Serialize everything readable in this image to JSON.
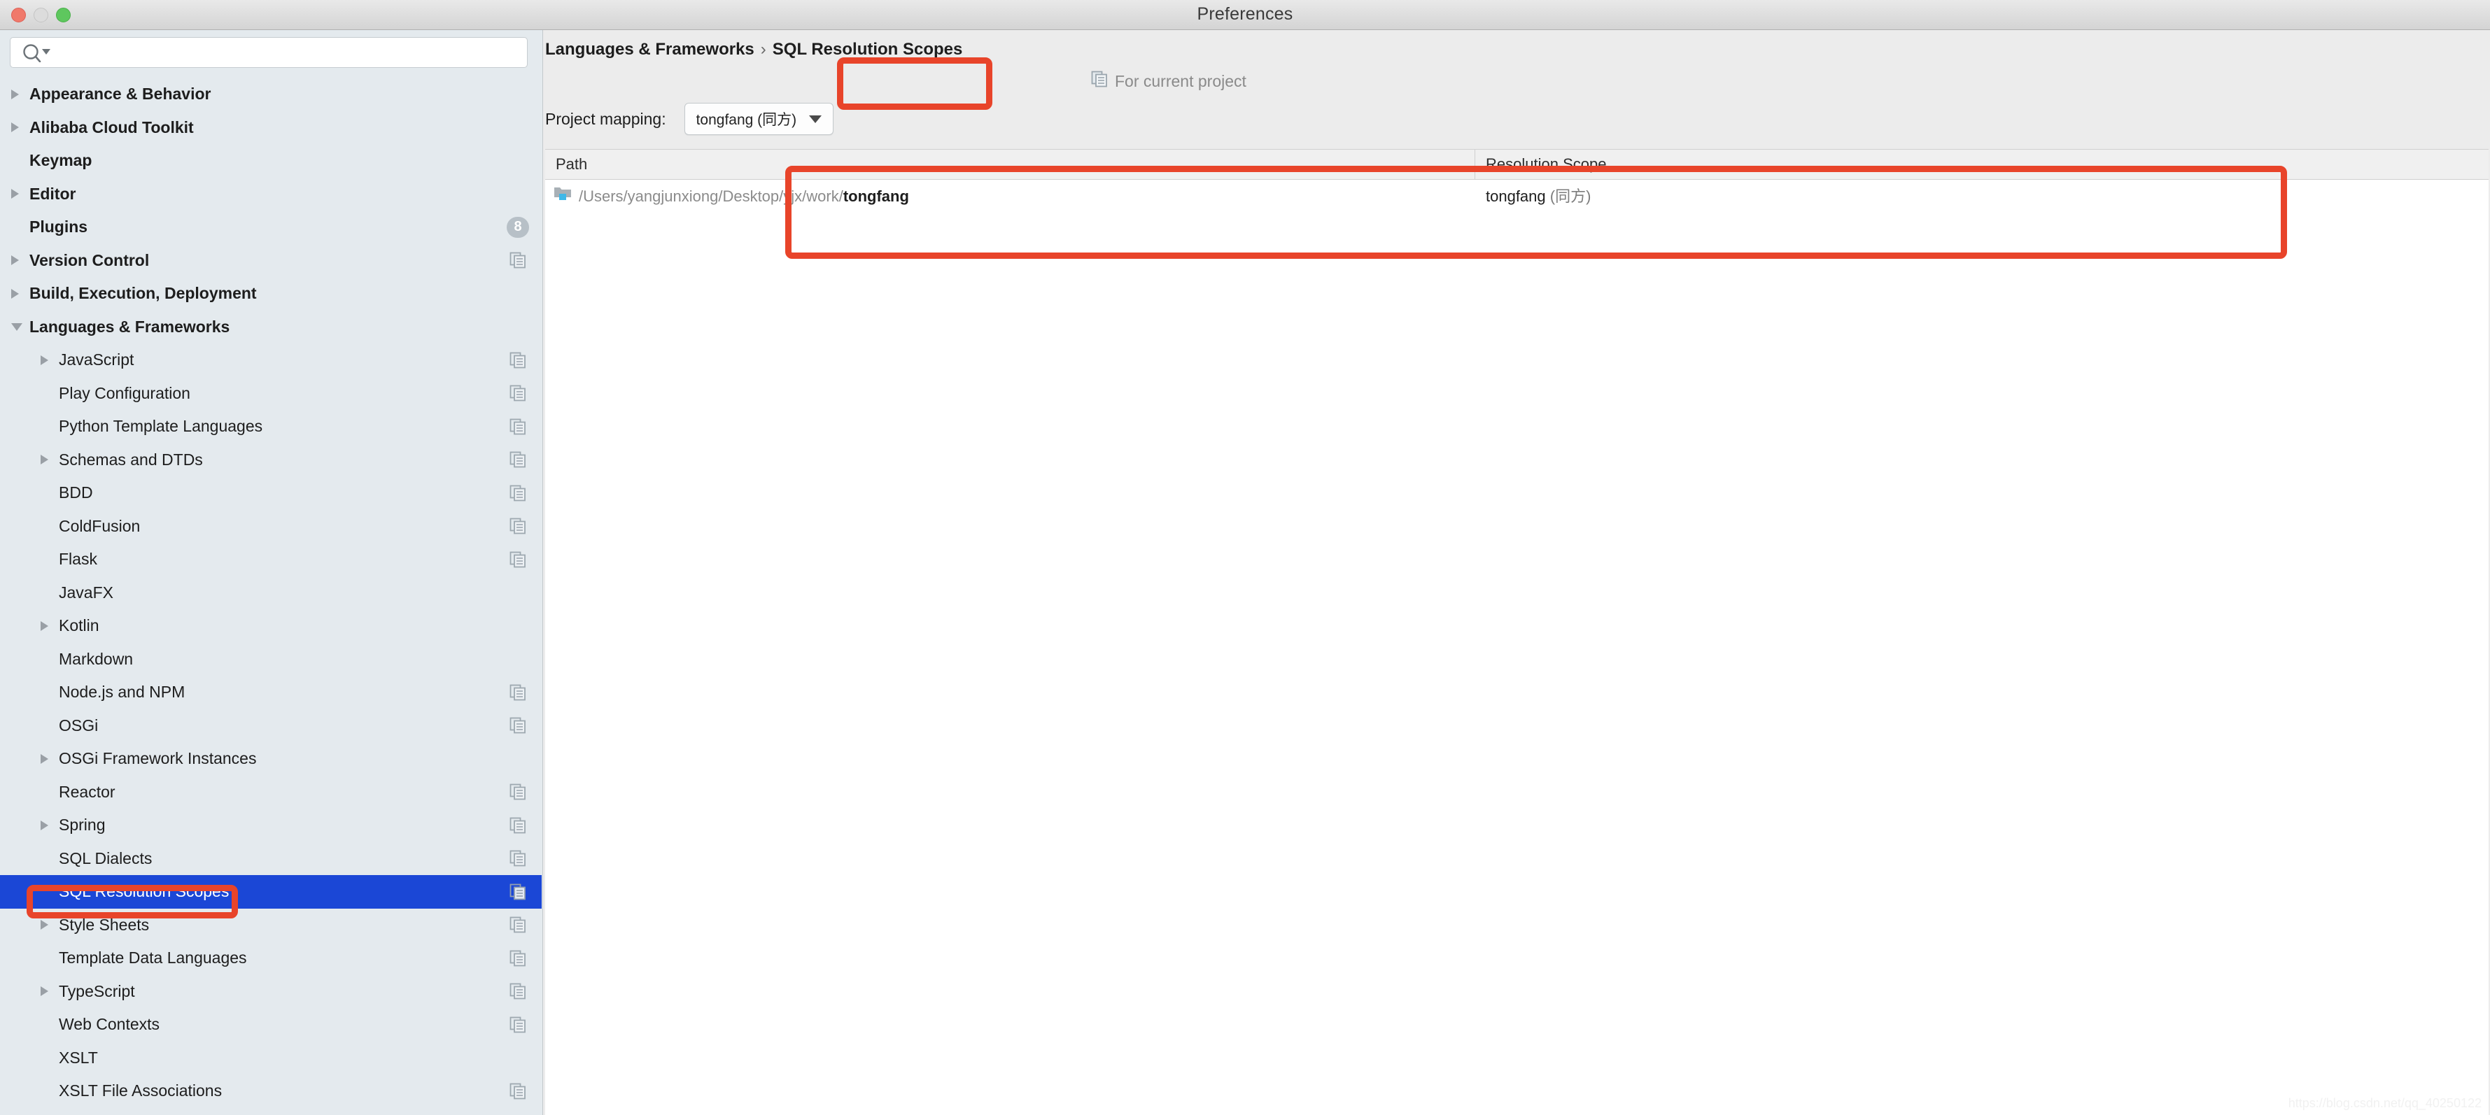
{
  "window": {
    "title": "Preferences",
    "controls": [
      "close",
      "minimize",
      "maximize"
    ]
  },
  "search": {
    "value": "",
    "placeholder": "",
    "icon": "search-icon"
  },
  "sidebar": {
    "items": [
      {
        "label": "Appearance & Behavior",
        "level": 0,
        "arrow": "collapsed",
        "icon": null,
        "badge": null,
        "selected": false
      },
      {
        "label": "Alibaba Cloud Toolkit",
        "level": 0,
        "arrow": "collapsed",
        "icon": null,
        "badge": null,
        "selected": false
      },
      {
        "label": "Keymap",
        "level": 0,
        "arrow": "none",
        "icon": null,
        "badge": null,
        "selected": false
      },
      {
        "label": "Editor",
        "level": 0,
        "arrow": "collapsed",
        "icon": null,
        "badge": null,
        "selected": false
      },
      {
        "label": "Plugins",
        "level": 0,
        "arrow": "none",
        "icon": null,
        "badge": "8",
        "selected": false
      },
      {
        "label": "Version Control",
        "level": 0,
        "arrow": "collapsed",
        "icon": "project-scope-icon",
        "badge": null,
        "selected": false
      },
      {
        "label": "Build, Execution, Deployment",
        "level": 0,
        "arrow": "collapsed",
        "icon": null,
        "badge": null,
        "selected": false
      },
      {
        "label": "Languages & Frameworks",
        "level": 0,
        "arrow": "expanded",
        "icon": null,
        "badge": null,
        "selected": false
      },
      {
        "label": "JavaScript",
        "level": 1,
        "arrow": "collapsed",
        "icon": "project-scope-icon",
        "badge": null,
        "selected": false
      },
      {
        "label": "Play Configuration",
        "level": 1,
        "arrow": "none",
        "icon": "project-scope-icon",
        "badge": null,
        "selected": false
      },
      {
        "label": "Python Template Languages",
        "level": 1,
        "arrow": "none",
        "icon": "project-scope-icon",
        "badge": null,
        "selected": false
      },
      {
        "label": "Schemas and DTDs",
        "level": 1,
        "arrow": "collapsed",
        "icon": "project-scope-icon",
        "badge": null,
        "selected": false
      },
      {
        "label": "BDD",
        "level": 1,
        "arrow": "none",
        "icon": "project-scope-icon",
        "badge": null,
        "selected": false
      },
      {
        "label": "ColdFusion",
        "level": 1,
        "arrow": "none",
        "icon": "project-scope-icon",
        "badge": null,
        "selected": false
      },
      {
        "label": "Flask",
        "level": 1,
        "arrow": "none",
        "icon": "project-scope-icon",
        "badge": null,
        "selected": false
      },
      {
        "label": "JavaFX",
        "level": 1,
        "arrow": "none",
        "icon": null,
        "badge": null,
        "selected": false
      },
      {
        "label": "Kotlin",
        "level": 1,
        "arrow": "collapsed",
        "icon": null,
        "badge": null,
        "selected": false
      },
      {
        "label": "Markdown",
        "level": 1,
        "arrow": "none",
        "icon": null,
        "badge": null,
        "selected": false
      },
      {
        "label": "Node.js and NPM",
        "level": 1,
        "arrow": "none",
        "icon": "project-scope-icon",
        "badge": null,
        "selected": false
      },
      {
        "label": "OSGi",
        "level": 1,
        "arrow": "none",
        "icon": "project-scope-icon",
        "badge": null,
        "selected": false
      },
      {
        "label": "OSGi Framework Instances",
        "level": 1,
        "arrow": "collapsed",
        "icon": null,
        "badge": null,
        "selected": false
      },
      {
        "label": "Reactor",
        "level": 1,
        "arrow": "none",
        "icon": "project-scope-icon",
        "badge": null,
        "selected": false
      },
      {
        "label": "Spring",
        "level": 1,
        "arrow": "collapsed",
        "icon": "project-scope-icon",
        "badge": null,
        "selected": false
      },
      {
        "label": "SQL Dialects",
        "level": 1,
        "arrow": "none",
        "icon": "project-scope-icon",
        "badge": null,
        "selected": false
      },
      {
        "label": "SQL Resolution Scopes",
        "level": 1,
        "arrow": "none",
        "icon": "project-scope-icon",
        "badge": null,
        "selected": true
      },
      {
        "label": "Style Sheets",
        "level": 1,
        "arrow": "collapsed",
        "icon": "project-scope-icon",
        "badge": null,
        "selected": false
      },
      {
        "label": "Template Data Languages",
        "level": 1,
        "arrow": "none",
        "icon": "project-scope-icon",
        "badge": null,
        "selected": false
      },
      {
        "label": "TypeScript",
        "level": 1,
        "arrow": "collapsed",
        "icon": "project-scope-icon",
        "badge": null,
        "selected": false
      },
      {
        "label": "Web Contexts",
        "level": 1,
        "arrow": "none",
        "icon": "project-scope-icon",
        "badge": null,
        "selected": false
      },
      {
        "label": "XSLT",
        "level": 1,
        "arrow": "none",
        "icon": null,
        "badge": null,
        "selected": false
      },
      {
        "label": "XSLT File Associations",
        "level": 1,
        "arrow": "none",
        "icon": "project-scope-icon",
        "badge": null,
        "selected": false
      }
    ]
  },
  "content": {
    "breadcrumb": {
      "parent": "Languages & Frameworks",
      "separator": "›",
      "current": "SQL Resolution Scopes"
    },
    "for_current_project": {
      "label": "For current project",
      "icon": "project-scope-icon"
    },
    "project_mapping": {
      "label": "Project mapping:",
      "selected": "tongfang (同方)",
      "options": [
        "tongfang (同方)"
      ],
      "caret": "chevron-down-icon"
    },
    "table": {
      "columns": [
        "Path",
        "Resolution Scope"
      ],
      "rows": [
        {
          "icon": "folder-module-icon",
          "path_prefix": "/Users/yangjunxiong/Desktop/yjx/work/",
          "path_name": "tongfang",
          "scope_name": "tongfang",
          "scope_suffix": "(同方)"
        }
      ]
    }
  },
  "annotations": {
    "color": "#e8442a",
    "boxes": [
      {
        "name": "project-mapping-highlight"
      },
      {
        "name": "table-highlight"
      },
      {
        "name": "sidebar-selection-highlight"
      }
    ]
  },
  "watermark": {
    "text": "https://blog.csdn.net/qq_40250122"
  }
}
